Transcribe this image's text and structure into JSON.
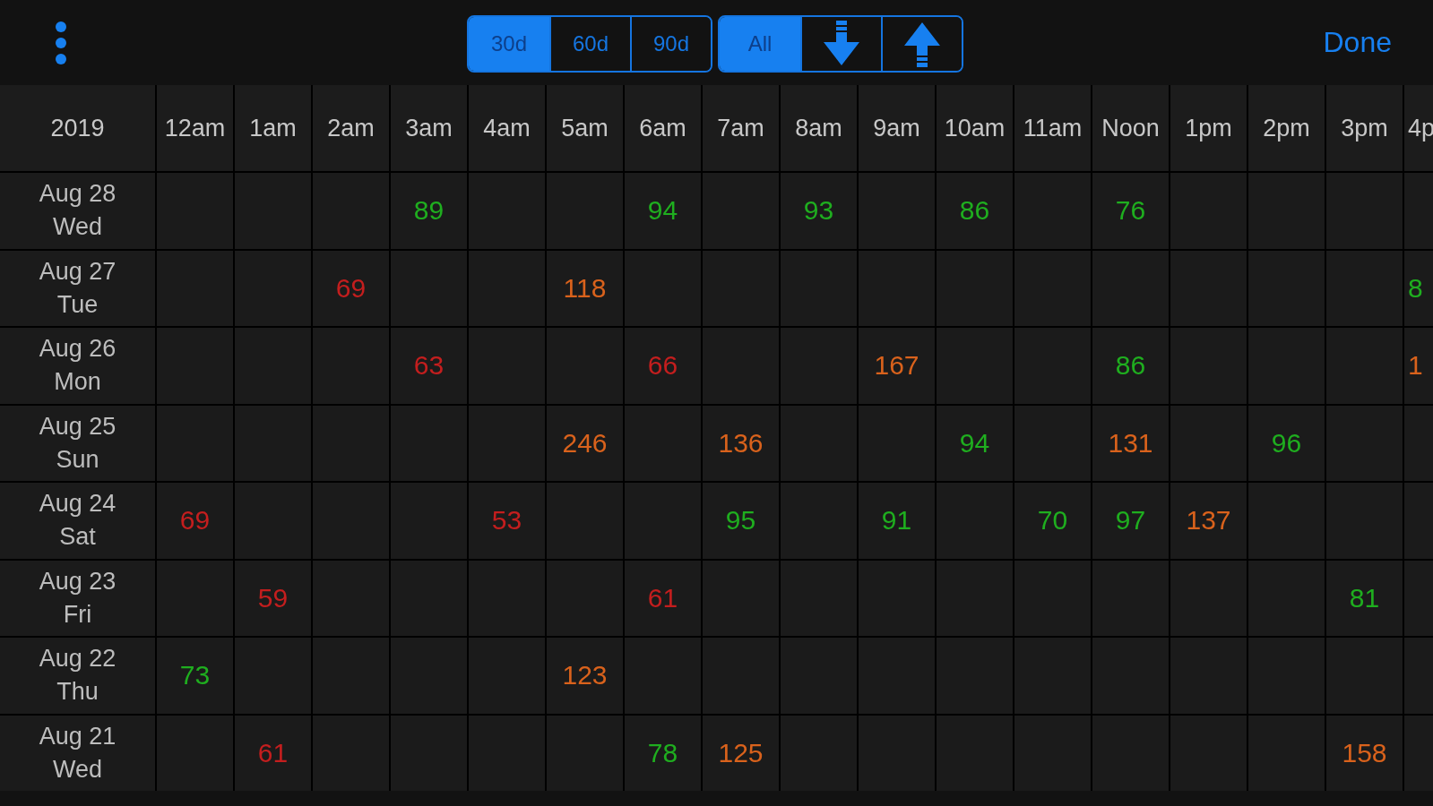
{
  "toolbar": {
    "range_segments": [
      {
        "label": "30d",
        "selected": true
      },
      {
        "label": "60d",
        "selected": false
      },
      {
        "label": "90d",
        "selected": false
      }
    ],
    "sort_segments": [
      {
        "kind": "text",
        "label": "All",
        "selected": true
      },
      {
        "kind": "down-arrow",
        "selected": false
      },
      {
        "kind": "up-arrow",
        "selected": false
      }
    ],
    "done": "Done"
  },
  "table": {
    "corner": "2019",
    "columns": [
      "12am",
      "1am",
      "2am",
      "3am",
      "4am",
      "5am",
      "6am",
      "7am",
      "8am",
      "9am",
      "10am",
      "11am",
      "Noon",
      "1pm",
      "2pm",
      "3pm",
      "4p"
    ],
    "rows": [
      {
        "date": "Aug 28",
        "day": "Wed",
        "cells": [
          null,
          null,
          null,
          {
            "value": "89",
            "color": "#1fae1f"
          },
          null,
          null,
          {
            "value": "94",
            "color": "#1fae1f"
          },
          null,
          {
            "value": "93",
            "color": "#1fae1f"
          },
          null,
          {
            "value": "86",
            "color": "#1fae1f"
          },
          null,
          {
            "value": "76",
            "color": "#1fae1f"
          },
          null,
          null,
          null,
          null
        ]
      },
      {
        "date": "Aug 27",
        "day": "Tue",
        "cells": [
          null,
          null,
          {
            "value": "69",
            "color": "#c41e1e"
          },
          null,
          null,
          {
            "value": "118",
            "color": "#d9621c"
          },
          null,
          null,
          null,
          null,
          null,
          null,
          null,
          null,
          null,
          null,
          {
            "value": "8",
            "color": "#1fae1f"
          }
        ]
      },
      {
        "date": "Aug 26",
        "day": "Mon",
        "cells": [
          null,
          null,
          null,
          {
            "value": "63",
            "color": "#c41e1e"
          },
          null,
          null,
          {
            "value": "66",
            "color": "#c41e1e"
          },
          null,
          null,
          {
            "value": "167",
            "color": "#d9621c"
          },
          null,
          null,
          {
            "value": "86",
            "color": "#1fae1f"
          },
          null,
          null,
          null,
          {
            "value": "1",
            "color": "#d9621c"
          }
        ]
      },
      {
        "date": "Aug 25",
        "day": "Sun",
        "cells": [
          null,
          null,
          null,
          null,
          null,
          {
            "value": "246",
            "color": "#d9621c"
          },
          null,
          {
            "value": "136",
            "color": "#d9621c"
          },
          null,
          null,
          {
            "value": "94",
            "color": "#1fae1f"
          },
          null,
          {
            "value": "131",
            "color": "#d9621c"
          },
          null,
          {
            "value": "96",
            "color": "#1fae1f"
          },
          null,
          null
        ]
      },
      {
        "date": "Aug 24",
        "day": "Sat",
        "cells": [
          {
            "value": "69",
            "color": "#c41e1e"
          },
          null,
          null,
          null,
          {
            "value": "53",
            "color": "#c41e1e"
          },
          null,
          null,
          {
            "value": "95",
            "color": "#1fae1f"
          },
          null,
          {
            "value": "91",
            "color": "#1fae1f"
          },
          null,
          {
            "value": "70",
            "color": "#1fae1f"
          },
          {
            "value": "97",
            "color": "#1fae1f"
          },
          {
            "value": "137",
            "color": "#d9621c"
          },
          null,
          null,
          null
        ]
      },
      {
        "date": "Aug 23",
        "day": "Fri",
        "cells": [
          null,
          {
            "value": "59",
            "color": "#c41e1e"
          },
          null,
          null,
          null,
          null,
          {
            "value": "61",
            "color": "#c41e1e"
          },
          null,
          null,
          null,
          null,
          null,
          null,
          null,
          null,
          {
            "value": "81",
            "color": "#1fae1f"
          },
          null
        ]
      },
      {
        "date": "Aug 22",
        "day": "Thu",
        "cells": [
          {
            "value": "73",
            "color": "#1fae1f"
          },
          null,
          null,
          null,
          null,
          {
            "value": "123",
            "color": "#d9621c"
          },
          null,
          null,
          null,
          null,
          null,
          null,
          null,
          null,
          null,
          null,
          null
        ]
      },
      {
        "date": "Aug 21",
        "day": "Wed",
        "cells": [
          null,
          {
            "value": "61",
            "color": "#c41e1e"
          },
          null,
          null,
          null,
          null,
          {
            "value": "78",
            "color": "#1fae1f"
          },
          {
            "value": "125",
            "color": "#d9621c"
          },
          null,
          null,
          null,
          null,
          null,
          null,
          null,
          {
            "value": "158",
            "color": "#d9621c"
          },
          null
        ]
      }
    ]
  }
}
